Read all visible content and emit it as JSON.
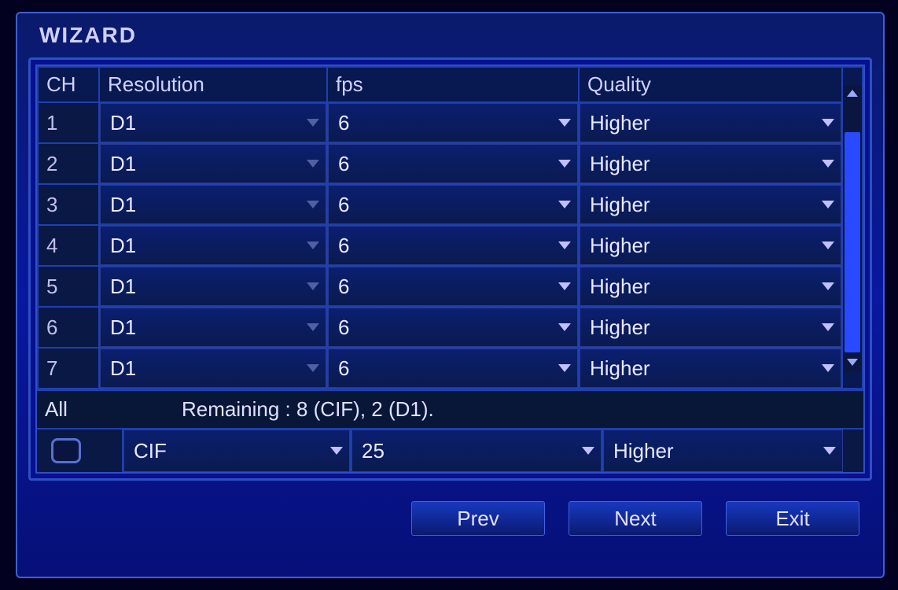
{
  "title": "WIZARD",
  "headers": {
    "ch": "CH",
    "resolution": "Resolution",
    "fps": "fps",
    "quality": "Quality"
  },
  "rows": [
    {
      "ch": "1",
      "resolution": "D1",
      "fps": "6",
      "quality": "Higher"
    },
    {
      "ch": "2",
      "resolution": "D1",
      "fps": "6",
      "quality": "Higher"
    },
    {
      "ch": "3",
      "resolution": "D1",
      "fps": "6",
      "quality": "Higher"
    },
    {
      "ch": "4",
      "resolution": "D1",
      "fps": "6",
      "quality": "Higher"
    },
    {
      "ch": "5",
      "resolution": "D1",
      "fps": "6",
      "quality": "Higher"
    },
    {
      "ch": "6",
      "resolution": "D1",
      "fps": "6",
      "quality": "Higher"
    },
    {
      "ch": "7",
      "resolution": "D1",
      "fps": "6",
      "quality": "Higher"
    }
  ],
  "status": {
    "label": "All",
    "remaining": "Remaining : 8 (CIF), 2 (D1)."
  },
  "all_row": {
    "resolution": "CIF",
    "fps": "25",
    "quality": "Higher"
  },
  "buttons": {
    "prev": "Prev",
    "next": "Next",
    "exit": "Exit"
  }
}
